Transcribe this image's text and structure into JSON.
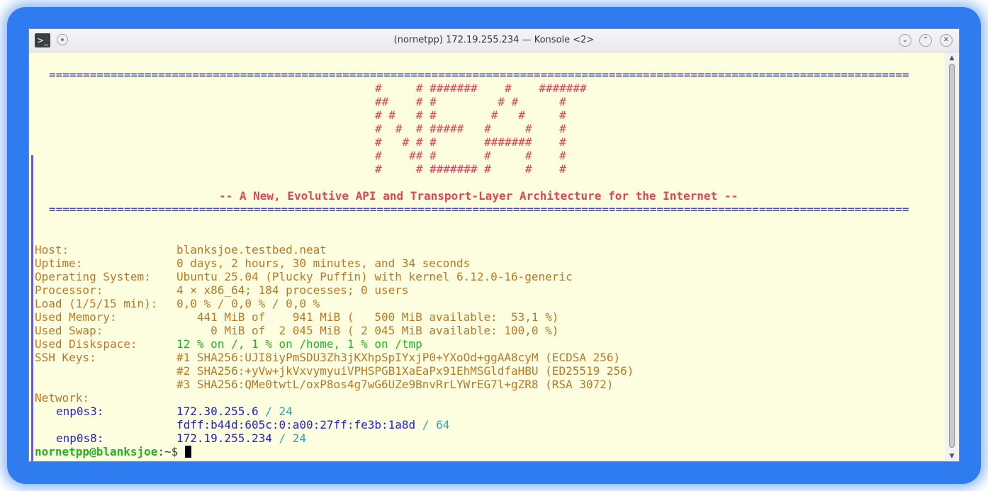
{
  "window": {
    "title": "(nornetpp) 172.19.255.234 — Konsole <2>",
    "app_icon": "terminal-icon",
    "buttons": {
      "minimize": "⌄",
      "maximize": "⌃",
      "close": "✕"
    }
  },
  "terminal": {
    "banner_rule": "==============================================================================================================================",
    "art_lines": [
      "#     # #######    #    #######",
      "##    # #         # #      #",
      "# #   # #        #   #     #",
      "#  #  # #####   #     #    #",
      "#   # # #       #######    #",
      "#    ## #       #     #    #",
      "#     # ####### #     #    #"
    ],
    "tagline": "-- A New, Evolutive API and Transport-Layer Architecture for the Internet --",
    "info": [
      {
        "label": "Host:",
        "value": "blanksjoe.testbed.neat"
      },
      {
        "label": "Uptime:",
        "value": "0 days, 2 hours, 30 minutes, and 34 seconds"
      },
      {
        "label": "Operating System:",
        "value": "Ubuntu 25.04 (Plucky Puffin) with kernel 6.12.0-16-generic"
      },
      {
        "label": "Processor:",
        "value": "4 × x86_64; 184 processes; 0 users"
      },
      {
        "label": "Load (1/5/15 min):",
        "value": "0,0 % / 0,0 % / 0,0 %"
      },
      {
        "label": "Used Memory:",
        "value": "   441 MiB of    941 MiB (   500 MiB available:  53,1 %)"
      },
      {
        "label": "Used Swap:",
        "value": "     0 MiB of  2 045 MiB ( 2 045 MiB available: 100,0 %)"
      },
      {
        "label": "Used Diskspace:",
        "value": "12 % on /, 1 % on /home, 1 % on /tmp"
      },
      {
        "label": "SSH Keys:",
        "value": "#1 SHA256:UJI8iyPmSDU3Zh3jKXhpSpIYxjP0+YXoOd+ggAA8cyM (ECDSA 256)"
      },
      {
        "label": "",
        "value": "#2 SHA256:+yVw+jkVxvymyuiVPHSPGB1XaEaPx91EhMSGldfaHBU (ED25519 256)"
      },
      {
        "label": "",
        "value": "#3 SHA256:QMe0twtL/oxP8os4g7wG6UZe9BnvRrLYWrEG7l+gZR8 (RSA 3072)"
      }
    ],
    "network_label": "Network:",
    "network": [
      {
        "iface": "enp0s3:",
        "addr": "172.30.255.6",
        "prefix": "/ 24"
      },
      {
        "iface": "",
        "addr": "fdff:b44d:605c:0:a00:27ff:fe3b:1a8d",
        "prefix": "/ 64"
      },
      {
        "iface": "enp0s8:",
        "addr": "172.19.255.234",
        "prefix": "/ 24"
      }
    ],
    "prompt": {
      "user_host": "nornetpp@blanksjoe",
      "path": ":~$ "
    }
  },
  "colors": {
    "background": "#fdfde0",
    "banner": "#2a2ad0",
    "art": "#e0465a",
    "label": "#b87a28",
    "green": "#28b028",
    "blue": "#2424c8",
    "cyan": "#2aa8b8"
  }
}
